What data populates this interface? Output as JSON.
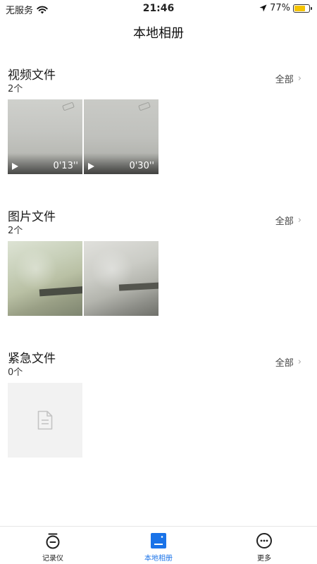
{
  "status_bar": {
    "carrier": "无服务",
    "time": "21:46",
    "battery_percent": "77%",
    "battery_level": 0.77,
    "icons": [
      "wifi-icon",
      "location-arrow-icon",
      "battery-icon"
    ]
  },
  "header": {
    "title": "本地相册"
  },
  "sections": [
    {
      "title": "视频文件",
      "count": "2个",
      "all_label": "全部",
      "items": [
        {
          "type": "video",
          "duration": "0'13''"
        },
        {
          "type": "video",
          "duration": "0'30''"
        }
      ]
    },
    {
      "title": "图片文件",
      "count": "2个",
      "all_label": "全部",
      "items": [
        {
          "type": "image"
        },
        {
          "type": "image"
        }
      ]
    },
    {
      "title": "紧急文件",
      "count": "0个",
      "all_label": "全部",
      "items": [
        {
          "type": "placeholder",
          "icon": "document-icon"
        }
      ]
    }
  ],
  "tab_bar": {
    "active": "本地相册",
    "accent_color": "#1a73e8",
    "tabs": [
      {
        "label": "记录仪",
        "icon": "recorder-icon"
      },
      {
        "label": "本地相册",
        "icon": "album-icon"
      },
      {
        "label": "更多",
        "icon": "more-icon"
      }
    ]
  }
}
